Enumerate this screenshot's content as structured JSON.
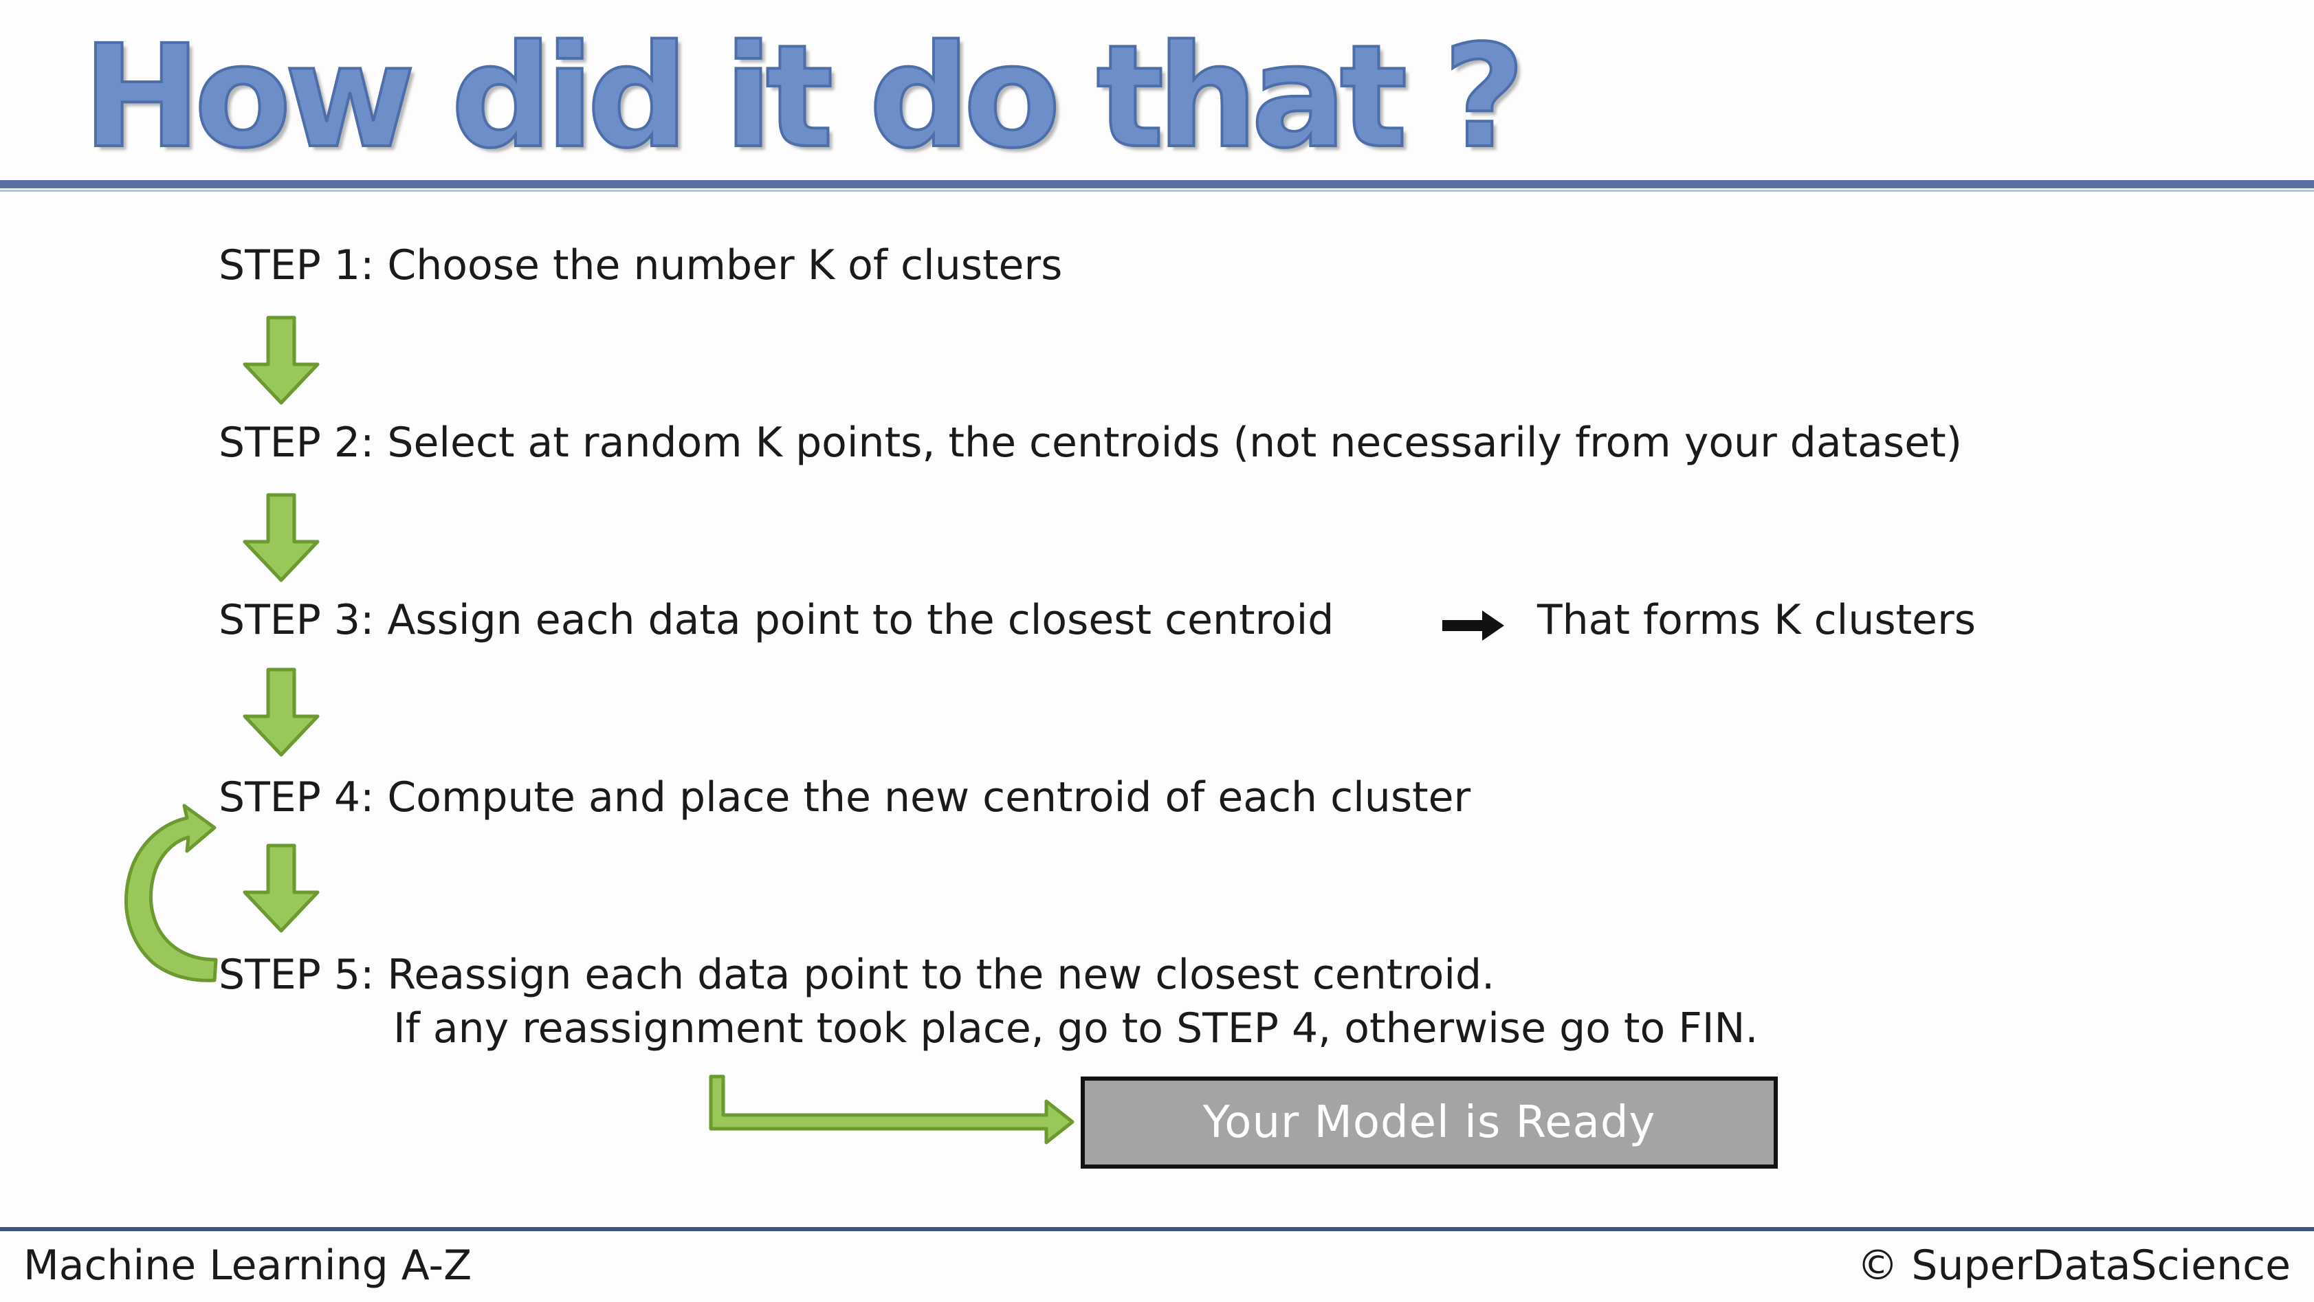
{
  "title": "How did it do that ?",
  "steps": [
    {
      "label": "STEP 1",
      "text": ": Choose the number K of clusters"
    },
    {
      "label": "STEP 2",
      "text": ": Select at random K points, the centroids (not necessarily from your dataset)"
    },
    {
      "label": "STEP 3",
      "text": ": Assign each data point to the closest centroid",
      "note": "That forms K clusters"
    },
    {
      "label": "STEP 4",
      "text": ": Compute and place the new centroid of each cluster"
    },
    {
      "label": "STEP 5",
      "text": ": Reassign each data point to the new closest centroid.",
      "text2": "If any reassignment took place, go to STEP 4, otherwise go to FIN."
    }
  ],
  "result_box": "Your Model is Ready",
  "footer": {
    "left": "Machine Learning A-Z",
    "right": "© SuperDataScience"
  },
  "colors": {
    "title": "#6d8ec8",
    "rule": "#5a70a2",
    "arrow_fill": "#9ac75a",
    "arrow_stroke": "#6c9a30",
    "box_fill": "#a4a4a4"
  }
}
